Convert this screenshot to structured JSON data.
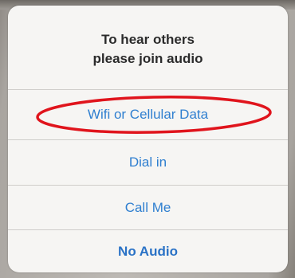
{
  "dialog": {
    "title_line1": "To hear others",
    "title_line2": "please join audio",
    "options": [
      {
        "label": "Wifi or Cellular Data",
        "highlighted": true
      },
      {
        "label": "Dial in"
      },
      {
        "label": "Call Me"
      },
      {
        "label": "No Audio",
        "bold": true
      }
    ]
  },
  "colors": {
    "option_text": "#2f7fd0",
    "annotation_circle": "#e0141c",
    "sheet_background": "#f6f5f3"
  }
}
